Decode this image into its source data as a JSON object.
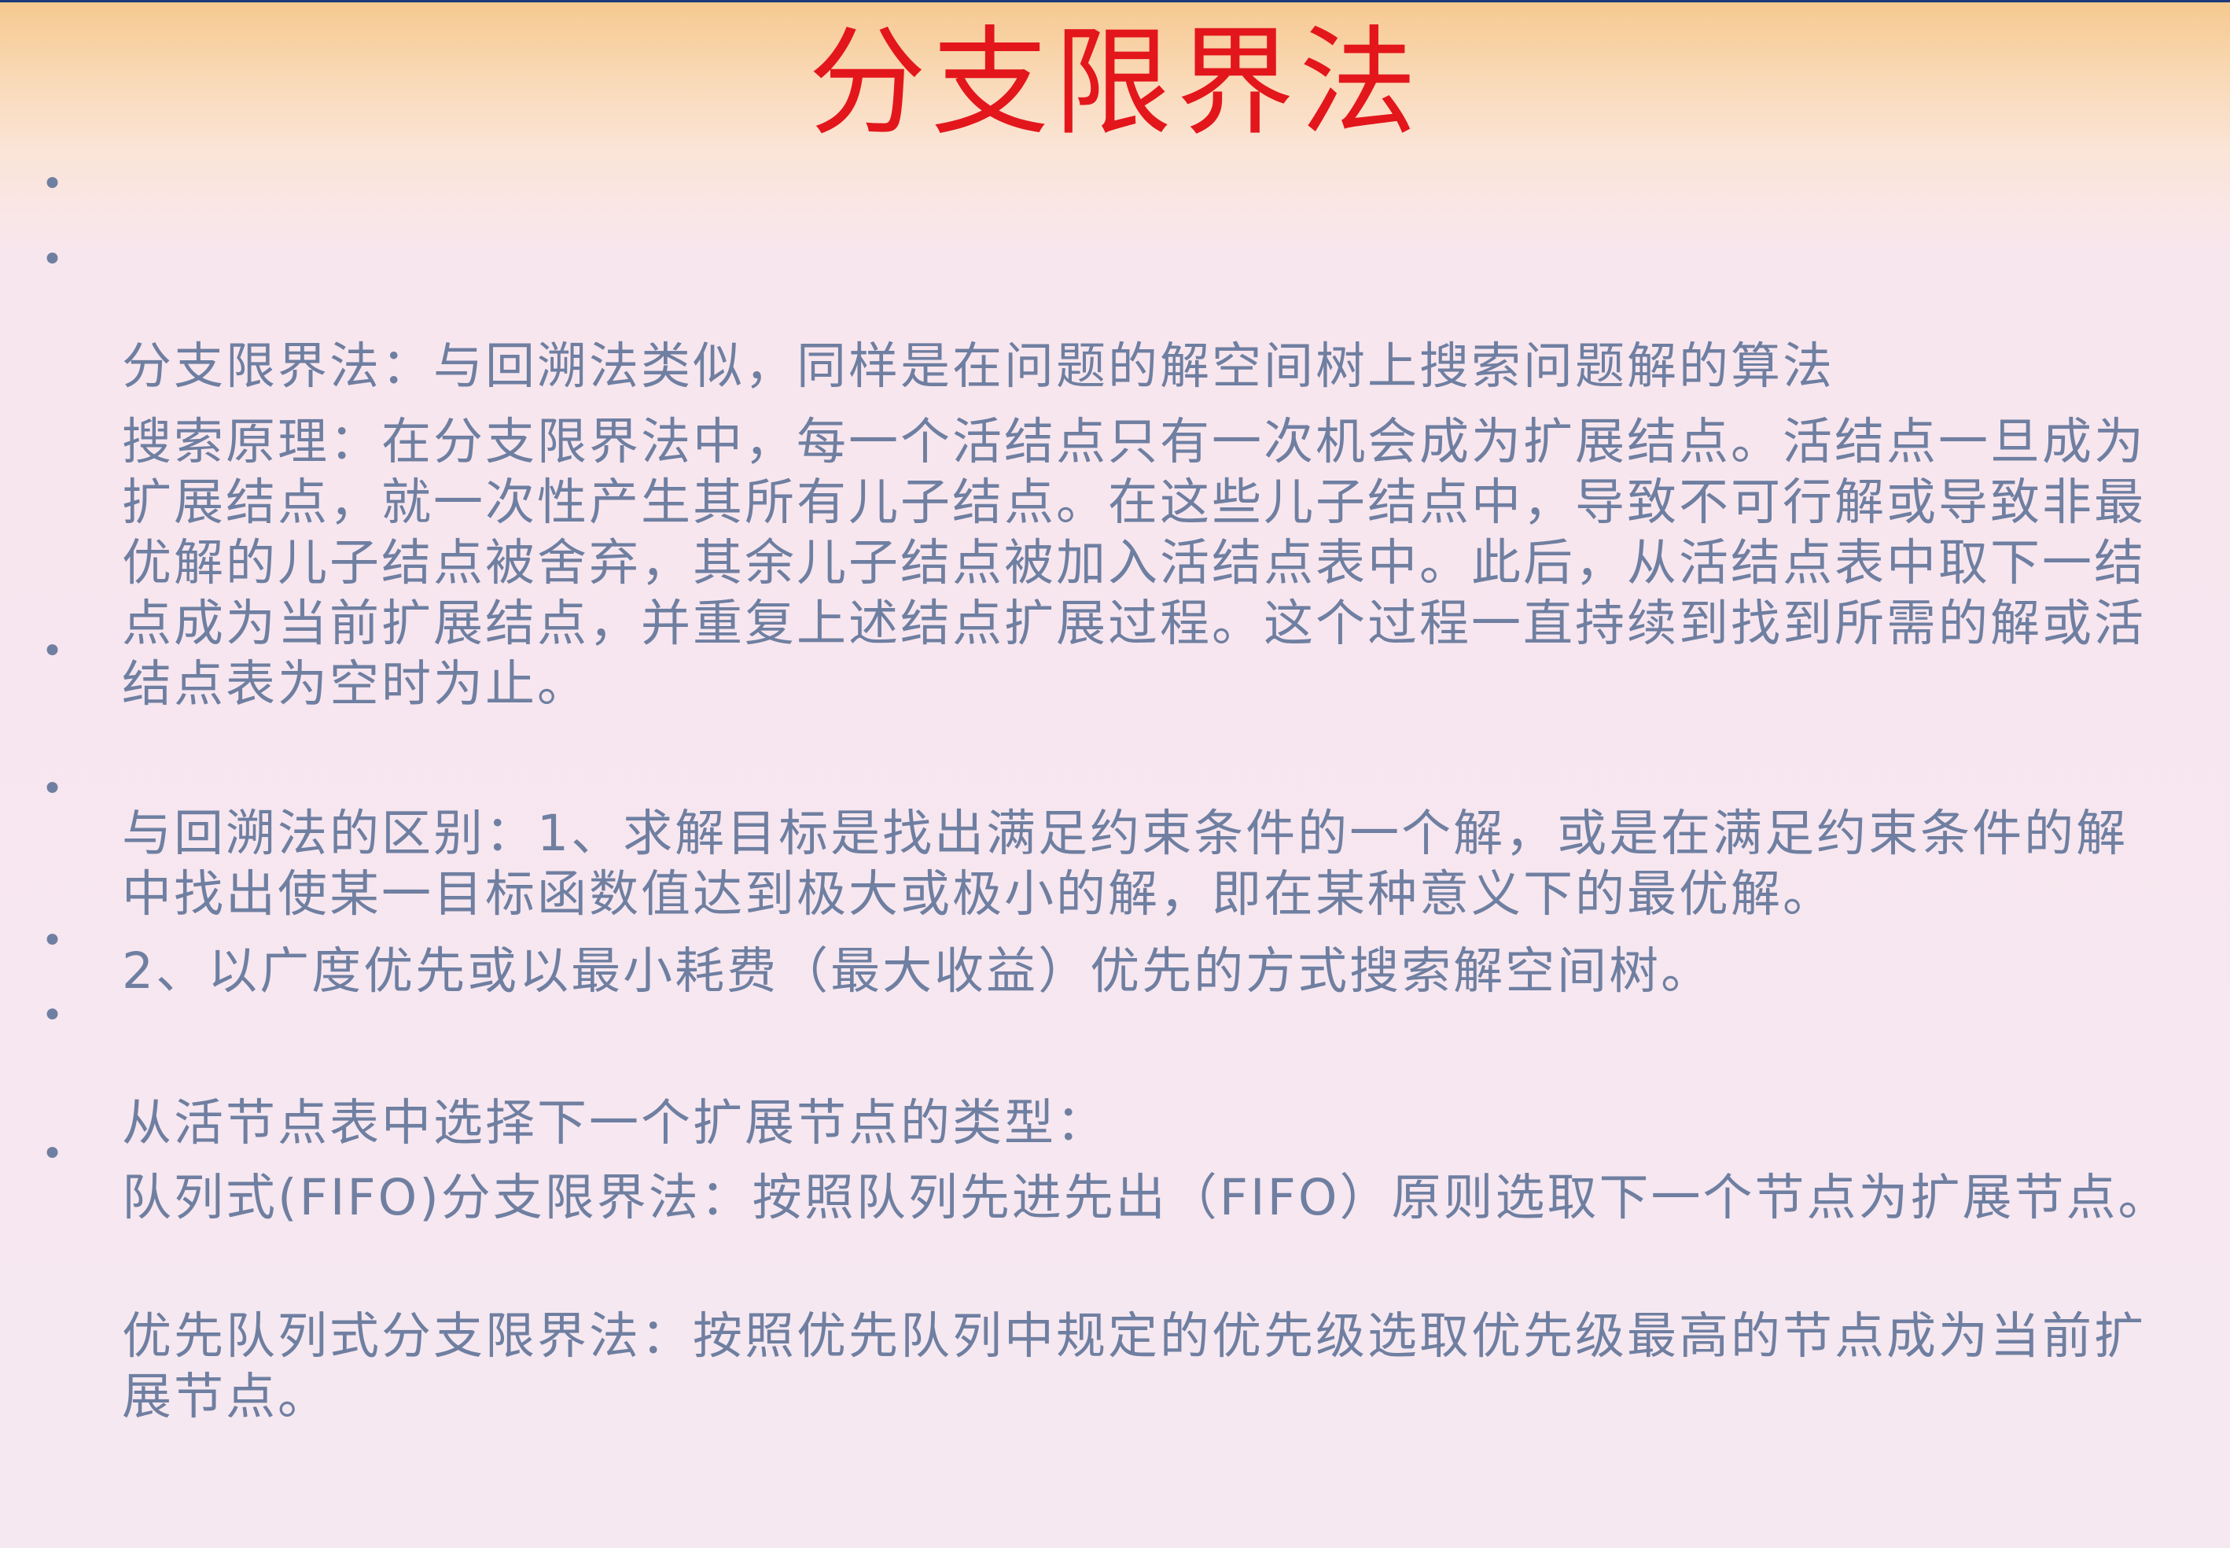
{
  "slide": {
    "title": "分支限界法",
    "bullet_char": "•",
    "bullets": [
      "分支限界法：与回溯法类似，同样是在问题的解空间树上搜索问题解的算法",
      "搜索原理：在分支限界法中，每一个活结点只有一次机会成为扩展结点。活结点一旦成为扩展结点，就一次性产生其所有儿子结点。在这些儿子结点中，导致不可行解或导致非最优解的儿子结点被舍弃，其余儿子结点被加入活结点表中。此后，从活结点表中取下一结点成为当前扩展结点，并重复上述结点扩展过程。这个过程一直持续到找到所需的解或活结点表为空时为止。",
      "与回溯法的区别：1、求解目标是找出满足约束条件的一个解，或是在满足约束条件的解中找出使某一目标函数值达到极大或极小的解，即在某种意义下的最优解。",
      "2、以广度优先或以最小耗费（最大收益）优先的方式搜索解空间树。",
      "从活节点表中选择下一个扩展节点的类型：",
      "队列式(FIFO)分支限界法：按照队列先进先出（FIFO）原则选取下一个节点为扩展节点。",
      "优先队列式分支限界法：按照优先队列中规定的优先级选取优先级最高的节点成为当前扩展节点。"
    ]
  },
  "colors": {
    "title": "#e3161c",
    "body_text": "#6f7fa1",
    "top_border": "#1f3b7a",
    "gradient_top": "#f6c98f",
    "background": "#f6e7f0"
  }
}
